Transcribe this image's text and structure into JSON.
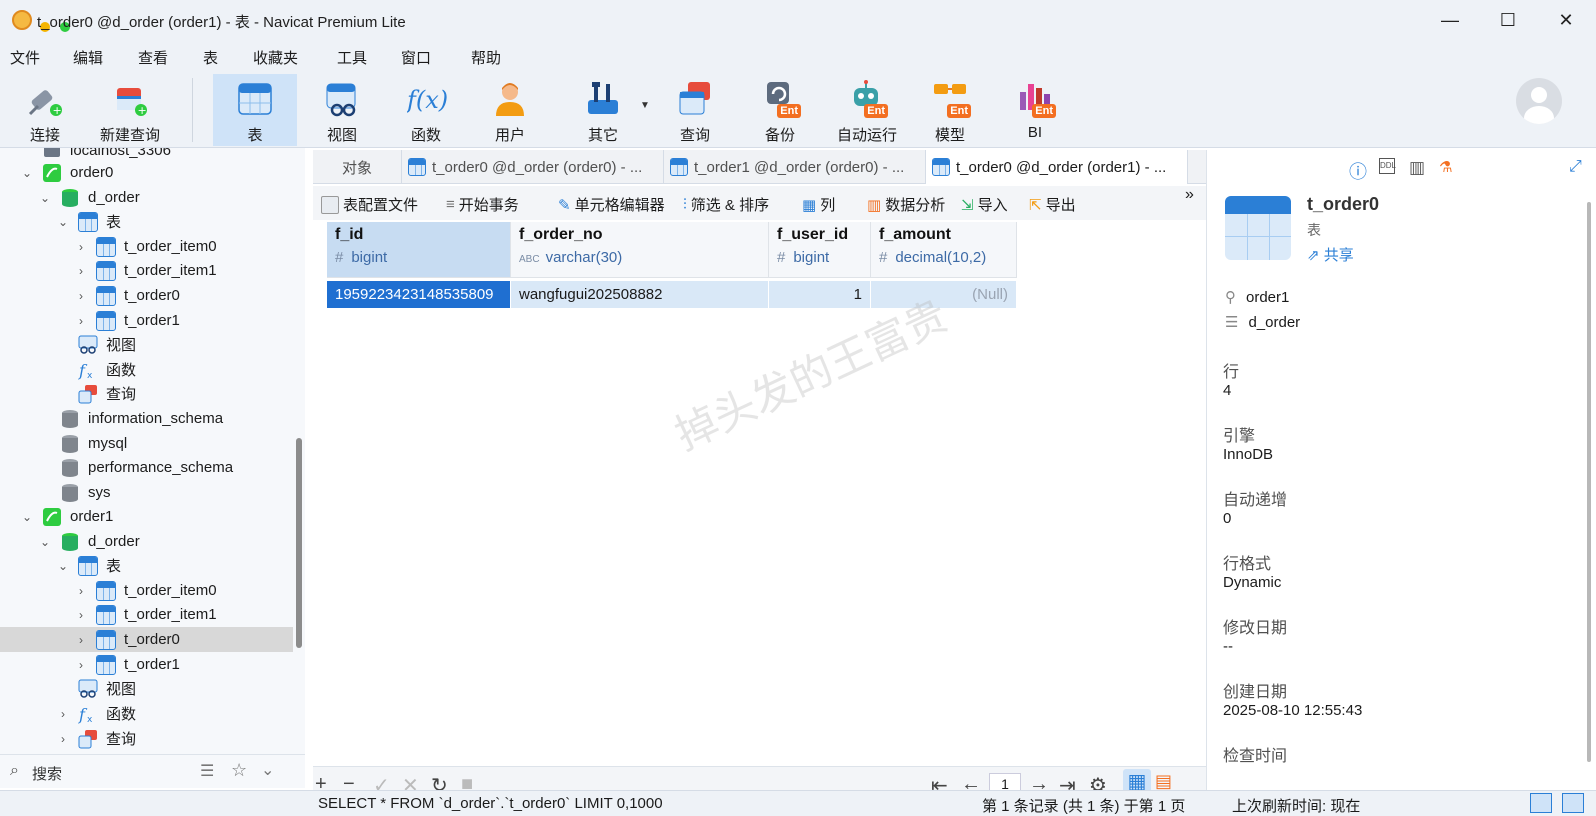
{
  "window": {
    "title": "t_order0 @d_order (order1) - 表 - Navicat Premium Lite",
    "controls": {
      "minimize": "—",
      "maximize": "☐",
      "close": "✕"
    }
  },
  "menu": [
    "文件",
    "编辑",
    "查看",
    "表",
    "收藏夹",
    "工具",
    "窗口",
    "帮助"
  ],
  "toolbar": {
    "connect": "连接",
    "new_query": "新建查询",
    "table": "表",
    "view": "视图",
    "function": "函数",
    "user": "用户",
    "other": "其它",
    "query": "查询",
    "backup": "备份",
    "auto_run": "自动运行",
    "model": "模型",
    "bi": "BI",
    "ent_badge": "Ent",
    "fx_glyph": "f(x)"
  },
  "sidebar": {
    "items": [
      {
        "label": "localhost_3306"
      },
      {
        "label": "order0"
      },
      {
        "label": "d_order"
      },
      {
        "label": "表"
      },
      {
        "label": "t_order_item0"
      },
      {
        "label": "t_order_item1"
      },
      {
        "label": "t_order0"
      },
      {
        "label": "t_order1"
      },
      {
        "label": "视图"
      },
      {
        "label": "函数"
      },
      {
        "label": "查询"
      },
      {
        "label": "information_schema"
      },
      {
        "label": "mysql"
      },
      {
        "label": "performance_schema"
      },
      {
        "label": "sys"
      },
      {
        "label": "order1"
      },
      {
        "label": "d_order"
      },
      {
        "label": "表"
      },
      {
        "label": "t_order_item0"
      },
      {
        "label": "t_order_item1"
      },
      {
        "label": "t_order0"
      },
      {
        "label": "t_order1"
      },
      {
        "label": "视图"
      },
      {
        "label": "函数"
      },
      {
        "label": "查询"
      }
    ],
    "search_placeholder": "搜索"
  },
  "tabs": {
    "objects": "对象",
    "tab1": "t_order0 @d_order (order0) - ...",
    "tab2": "t_order1 @d_order (order0) - ...",
    "tab3": "t_order0 @d_order (order1) - ..."
  },
  "grid_toolbar": {
    "config_file": "表配置文件",
    "begin_tx": "开始事务",
    "cell_editor": "单元格编辑器",
    "filter_sort": "筛选 & 排序",
    "columns": "列",
    "data_analysis": "数据分析",
    "import": "导入",
    "export": "导出"
  },
  "grid": {
    "columns": [
      {
        "name": "f_id",
        "type": "bigint",
        "type_icon": "#"
      },
      {
        "name": "f_order_no",
        "type": "varchar(30)",
        "type_icon": "ABC"
      },
      {
        "name": "f_user_id",
        "type": "bigint",
        "type_icon": "#"
      },
      {
        "name": "f_amount",
        "type": "decimal(10,2)",
        "type_icon": "#"
      }
    ],
    "rows": [
      [
        "1959223423148535809",
        "wangfugui202508882",
        "1",
        "(Null)"
      ]
    ],
    "watermark": "掉头发的王富贵"
  },
  "pagination": {
    "page": "1"
  },
  "status": {
    "sql": "SELECT * FROM `d_order`.`t_order0` LIMIT 0,1000",
    "records": "第 1 条记录 (共 1 条) 于第 1 页",
    "refresh": "上次刷新时间: 现在"
  },
  "info_panel": {
    "name": "t_order0",
    "type": "表",
    "share": "共享",
    "connection": "order1",
    "database": "d_order",
    "ddl_badge": "DDL",
    "fields": [
      {
        "label": "行",
        "value": "4"
      },
      {
        "label": "引擎",
        "value": "InnoDB"
      },
      {
        "label": "自动递增",
        "value": "0"
      },
      {
        "label": "行格式",
        "value": "Dynamic"
      },
      {
        "label": "修改日期",
        "value": "--"
      },
      {
        "label": "创建日期",
        "value": "2025-08-10 12:55:43"
      },
      {
        "label": "检查时间",
        "value": ""
      }
    ]
  },
  "colors": {
    "accent": "#2b7fd6",
    "selection": "#1f6fd1",
    "ent_orange": "#f36f21"
  }
}
